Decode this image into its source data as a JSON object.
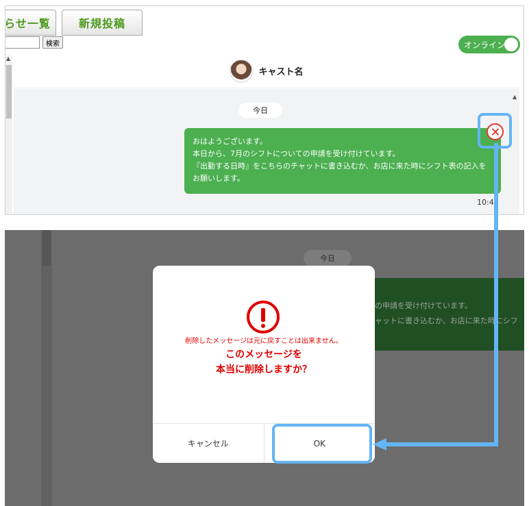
{
  "top": {
    "tabs": {
      "notices_label": "らせ一覧",
      "new_post_label": "新規投稿"
    },
    "search": {
      "value": "",
      "button_label": "検索"
    },
    "online_toggle_label": "オンライン",
    "chat": {
      "cast_name": "キャスト名",
      "date_label": "今日",
      "message_lines": [
        "おはようございます。",
        "本日から、7月のシフトについての申請を受け付けています。",
        "『出勤する日時』をこちらのチャットに書き込むか、お店に来た時にシフト表の記入を",
        "お願いします。"
      ],
      "time": "10:42"
    }
  },
  "bottom": {
    "background": {
      "date_label": "今日",
      "message_fragment_lines": [
        "の申請を受け付けています。",
        "ャットに書き込むか、お店に来た時にシフ"
      ]
    },
    "dialog": {
      "note": "削除したメッセージは元に戻すことは出来ません。",
      "question_line1": "このメッセージを",
      "question_line2": "本当に削除しますか？",
      "cancel_label": "キャンセル",
      "ok_label": "OK"
    }
  },
  "colors": {
    "accent_green": "#4caf50",
    "highlight_blue": "#64b5f6",
    "alert_red": "#e00000"
  }
}
